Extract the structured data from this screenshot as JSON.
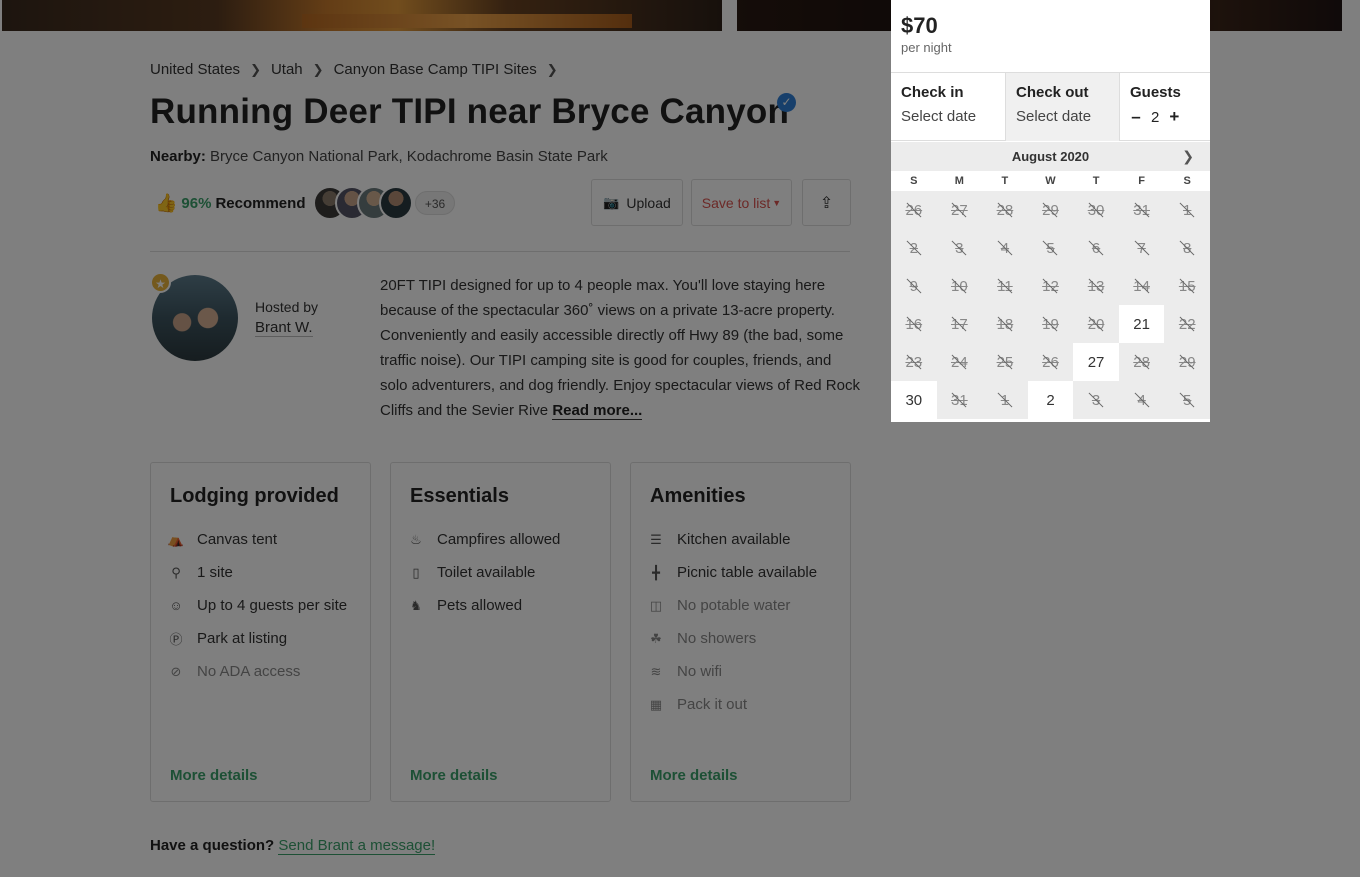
{
  "breadcrumb": [
    "United States",
    "Utah",
    "Canyon Base Camp TIPI Sites"
  ],
  "listing": {
    "title": "Running Deer TIPI near Bryce Canyon",
    "nearby_label": "Nearby:",
    "nearby_value": "Bryce Canyon National Park, Kodachrome Basin State Park",
    "recommend_pct": "96%",
    "recommend_label": "Recommend",
    "avatars_more": "+36"
  },
  "actions": {
    "upload": "Upload",
    "save": "Save to list"
  },
  "host": {
    "hosted_by": "Hosted by",
    "name": "Brant W."
  },
  "description": {
    "text": "20FT TIPI designed for up to 4 people max. You'll love staying here because of the spectacular 360˚ views on a private 13-acre property. Conveniently and easily accessible directly off Hwy 89 (the bad, some traffic noise). Our TIPI camping site is good for couples, friends, and solo adventurers, and dog friendly. Enjoy spectacular views of Red Rock Cliffs and the Sevier Rive",
    "read_more": "Read more..."
  },
  "cards": [
    {
      "title": "Lodging provided",
      "items": [
        {
          "icon": "tent-icon",
          "label": "Canvas tent",
          "negative": false
        },
        {
          "icon": "location-pin-icon",
          "label": "1 site",
          "negative": false
        },
        {
          "icon": "guests-icon",
          "label": "Up to 4 guests per site",
          "negative": false
        },
        {
          "icon": "parking-icon",
          "label": "Park at listing",
          "negative": false
        },
        {
          "icon": "no-ada-icon",
          "label": "No ADA access",
          "negative": true
        }
      ],
      "more": "More details"
    },
    {
      "title": "Essentials",
      "items": [
        {
          "icon": "campfire-icon",
          "label": "Campfires allowed",
          "negative": false
        },
        {
          "icon": "toilet-icon",
          "label": "Toilet available",
          "negative": false
        },
        {
          "icon": "pet-icon",
          "label": "Pets allowed",
          "negative": false
        }
      ],
      "more": "More details"
    },
    {
      "title": "Amenities",
      "items": [
        {
          "icon": "kitchen-icon",
          "label": "Kitchen available",
          "negative": false
        },
        {
          "icon": "picnic-table-icon",
          "label": "Picnic table available",
          "negative": false
        },
        {
          "icon": "no-water-icon",
          "label": "No potable water",
          "negative": true
        },
        {
          "icon": "no-shower-icon",
          "label": "No showers",
          "negative": true
        },
        {
          "icon": "no-wifi-icon",
          "label": "No wifi",
          "negative": true
        },
        {
          "icon": "trash-icon",
          "label": "Pack it out",
          "negative": true
        }
      ],
      "more": "More details"
    }
  ],
  "question": {
    "label": "Have a question?",
    "link": "Send Brant a message!"
  },
  "booking": {
    "price": "$70",
    "per_night": "per night",
    "checkin_label": "Check in",
    "checkin_value": "Select date",
    "checkout_label": "Check out",
    "checkout_value": "Select date",
    "guests_label": "Guests",
    "guests_minus": "–",
    "guests_count": "2",
    "guests_plus": "+"
  },
  "calendar": {
    "month": "August 2020",
    "weekdays": [
      "S",
      "M",
      "T",
      "W",
      "T",
      "F",
      "S"
    ],
    "days": [
      {
        "d": "26",
        "available": false
      },
      {
        "d": "27",
        "available": false
      },
      {
        "d": "28",
        "available": false
      },
      {
        "d": "29",
        "available": false
      },
      {
        "d": "30",
        "available": false
      },
      {
        "d": "31",
        "available": false
      },
      {
        "d": "1",
        "available": false
      },
      {
        "d": "2",
        "available": false
      },
      {
        "d": "3",
        "available": false
      },
      {
        "d": "4",
        "available": false
      },
      {
        "d": "5",
        "available": false
      },
      {
        "d": "6",
        "available": false
      },
      {
        "d": "7",
        "available": false
      },
      {
        "d": "8",
        "available": false
      },
      {
        "d": "9",
        "available": false
      },
      {
        "d": "10",
        "available": false
      },
      {
        "d": "11",
        "available": false
      },
      {
        "d": "12",
        "available": false
      },
      {
        "d": "13",
        "available": false
      },
      {
        "d": "14",
        "available": false
      },
      {
        "d": "15",
        "available": false
      },
      {
        "d": "16",
        "available": false
      },
      {
        "d": "17",
        "available": false
      },
      {
        "d": "18",
        "available": false
      },
      {
        "d": "19",
        "available": false
      },
      {
        "d": "20",
        "available": false
      },
      {
        "d": "21",
        "available": true
      },
      {
        "d": "22",
        "available": false
      },
      {
        "d": "23",
        "available": false
      },
      {
        "d": "24",
        "available": false
      },
      {
        "d": "25",
        "available": false
      },
      {
        "d": "26",
        "available": false
      },
      {
        "d": "27",
        "available": true
      },
      {
        "d": "28",
        "available": false
      },
      {
        "d": "29",
        "available": false
      },
      {
        "d": "30",
        "available": true
      },
      {
        "d": "31",
        "available": false
      },
      {
        "d": "1",
        "available": false
      },
      {
        "d": "2",
        "available": true
      },
      {
        "d": "3",
        "available": false
      },
      {
        "d": "4",
        "available": false
      },
      {
        "d": "5",
        "available": false
      }
    ]
  }
}
